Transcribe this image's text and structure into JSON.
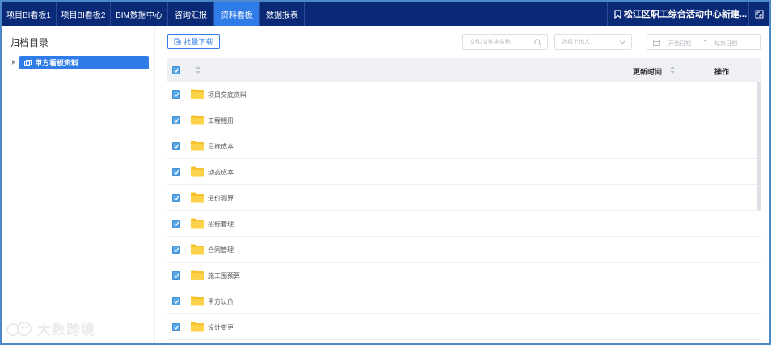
{
  "nav": {
    "tabs": [
      {
        "label": "项目BI看板1",
        "active": false
      },
      {
        "label": "项目BI看板2",
        "active": false
      },
      {
        "label": "BIM数据中心",
        "active": false
      },
      {
        "label": "咨询汇报",
        "active": false
      },
      {
        "label": "资料看板",
        "active": true
      },
      {
        "label": "数据报表",
        "active": false
      }
    ],
    "project_name": "松江区职工综合活动中心新建...",
    "icons": [
      "bookmark-icon",
      "fullscreen-icon"
    ]
  },
  "sidebar": {
    "title": "归档目录",
    "tree": [
      {
        "label": "甲方看板资料",
        "selected": true
      }
    ]
  },
  "toolbar": {
    "batch_download_label": "批量下载",
    "search_placeholder": "文件/文件夹名称",
    "uploader_placeholder": "选择上传人",
    "start_date_placeholder": "开始日期",
    "date_separator": "-",
    "end_date_placeholder": "结束日期"
  },
  "table": {
    "columns": {
      "updated_time": "更新时间",
      "actions": "操作"
    },
    "rows": [
      {
        "name": "项目交底资料"
      },
      {
        "name": "工程相册"
      },
      {
        "name": "目标成本"
      },
      {
        "name": "动态成本"
      },
      {
        "name": "造价测算"
      },
      {
        "name": "招标管理"
      },
      {
        "name": "合同管理"
      },
      {
        "name": "施工图预算"
      },
      {
        "name": "甲方认价"
      },
      {
        "name": "设计变更"
      }
    ]
  },
  "watermark": {
    "text": "大数跨境"
  },
  "colors": {
    "nav_bg": "#0a2a78",
    "accent": "#2f7be8",
    "folder": "#f7c02c",
    "checkbox": "#5aa7e6"
  }
}
